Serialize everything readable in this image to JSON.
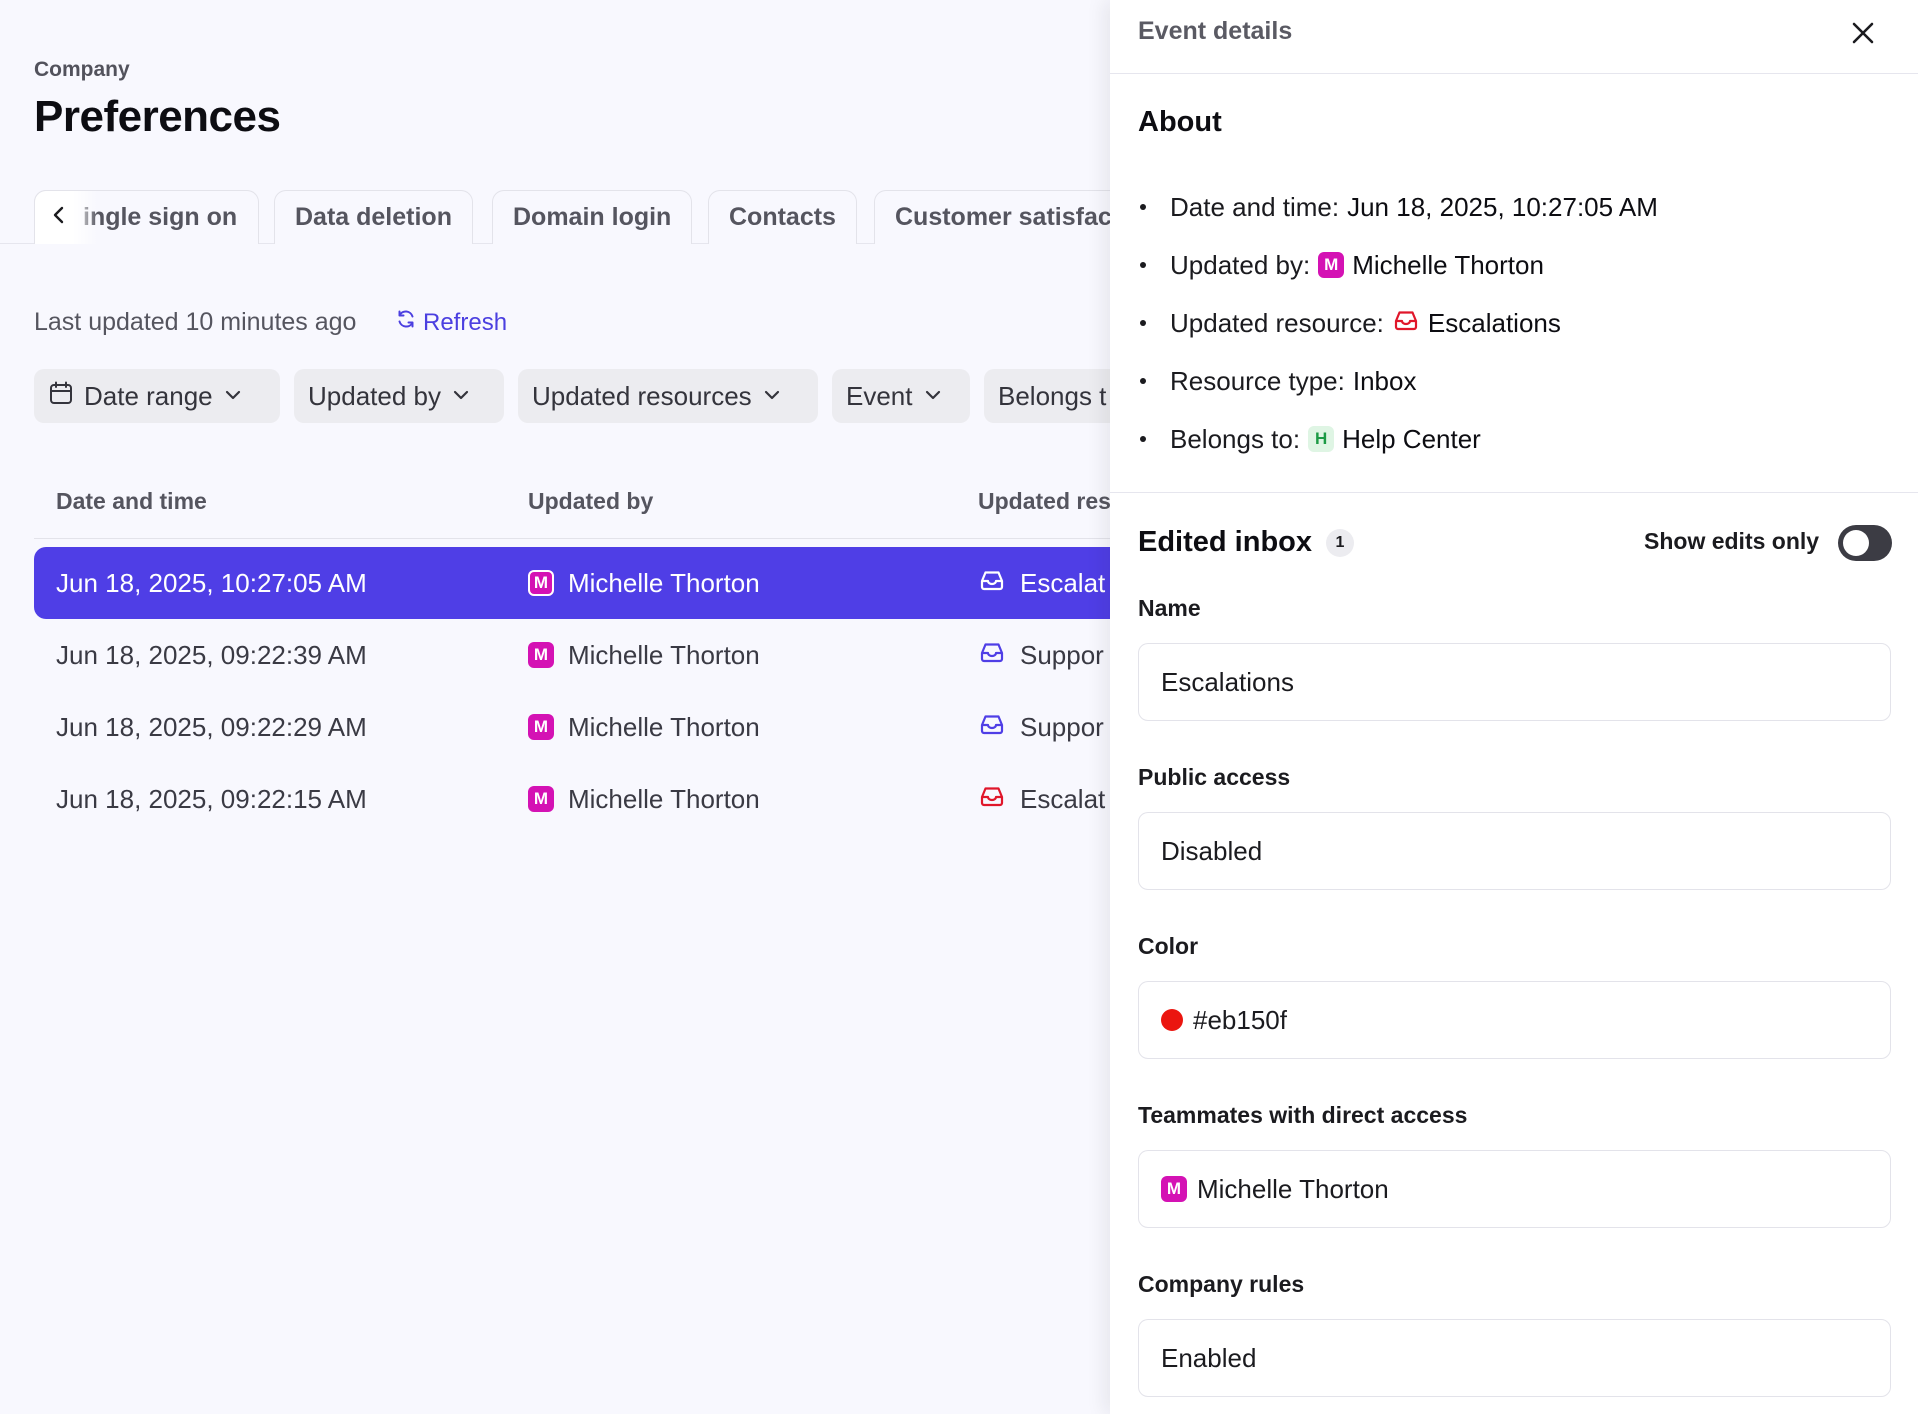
{
  "page": {
    "eyebrow": "Company",
    "title": "Preferences"
  },
  "tabs": [
    {
      "label": "ingle sign on"
    },
    {
      "label": "Data deletion"
    },
    {
      "label": "Domain login"
    },
    {
      "label": "Contacts"
    },
    {
      "label": "Customer satisfac"
    }
  ],
  "status": {
    "last_updated": "Last updated 10 minutes ago",
    "refresh_label": "Refresh"
  },
  "filters": [
    {
      "label": "Date range"
    },
    {
      "label": "Updated by"
    },
    {
      "label": "Updated resources"
    },
    {
      "label": "Event"
    },
    {
      "label": "Belongs t"
    }
  ],
  "table": {
    "columns": [
      "Date and time",
      "Updated by",
      "Updated res"
    ],
    "rows": [
      {
        "date": "Jun 18, 2025, 10:27:05 AM",
        "avatar": "M",
        "user": "Michelle Thorton",
        "resource": "Escalat",
        "icon_color": "#ffffff",
        "selected": true
      },
      {
        "date": "Jun 18, 2025, 09:22:39 AM",
        "avatar": "M",
        "user": "Michelle Thorton",
        "resource": "Suppor",
        "icon_color": "#4f3ee6",
        "selected": false
      },
      {
        "date": "Jun 18, 2025, 09:22:29 AM",
        "avatar": "M",
        "user": "Michelle Thorton",
        "resource": "Suppor",
        "icon_color": "#4f3ee6",
        "selected": false
      },
      {
        "date": "Jun 18, 2025, 09:22:15 AM",
        "avatar": "M",
        "user": "Michelle Thorton",
        "resource": "Escalat",
        "icon_color": "#e0162a",
        "selected": false
      }
    ]
  },
  "panel": {
    "title": "Event details",
    "about_title": "About",
    "about": {
      "date_key": "Date and time:",
      "date_val": "Jun 18, 2025, 10:27:05 AM",
      "updated_by_key": "Updated by:",
      "updated_by_avatar": "M",
      "updated_by_val": "Michelle Thorton",
      "resource_key": "Updated resource:",
      "resource_val": "Escalations",
      "type_key": "Resource type:",
      "type_val": "Inbox",
      "belongs_key": "Belongs to:",
      "belongs_avatar": "H",
      "belongs_val": "Help Center"
    },
    "edited_title": "Edited inbox",
    "edited_count": "1",
    "show_edits_label": "Show edits only",
    "show_edits_on": false,
    "fields": {
      "name_label": "Name",
      "name_value": "Escalations",
      "public_label": "Public access",
      "public_value": "Disabled",
      "color_label": "Color",
      "color_value": "#eb150f",
      "teammates_label": "Teammates with direct access",
      "teammates_avatar": "M",
      "teammates_value": "Michelle Thorton",
      "rules_label": "Company rules",
      "rules_value": "Enabled"
    }
  },
  "colors": {
    "accent": "#4f3ee6",
    "avatar_m": "#d412b4",
    "escalations_red": "#e0162a",
    "help_center_green": "#1c9a45"
  }
}
